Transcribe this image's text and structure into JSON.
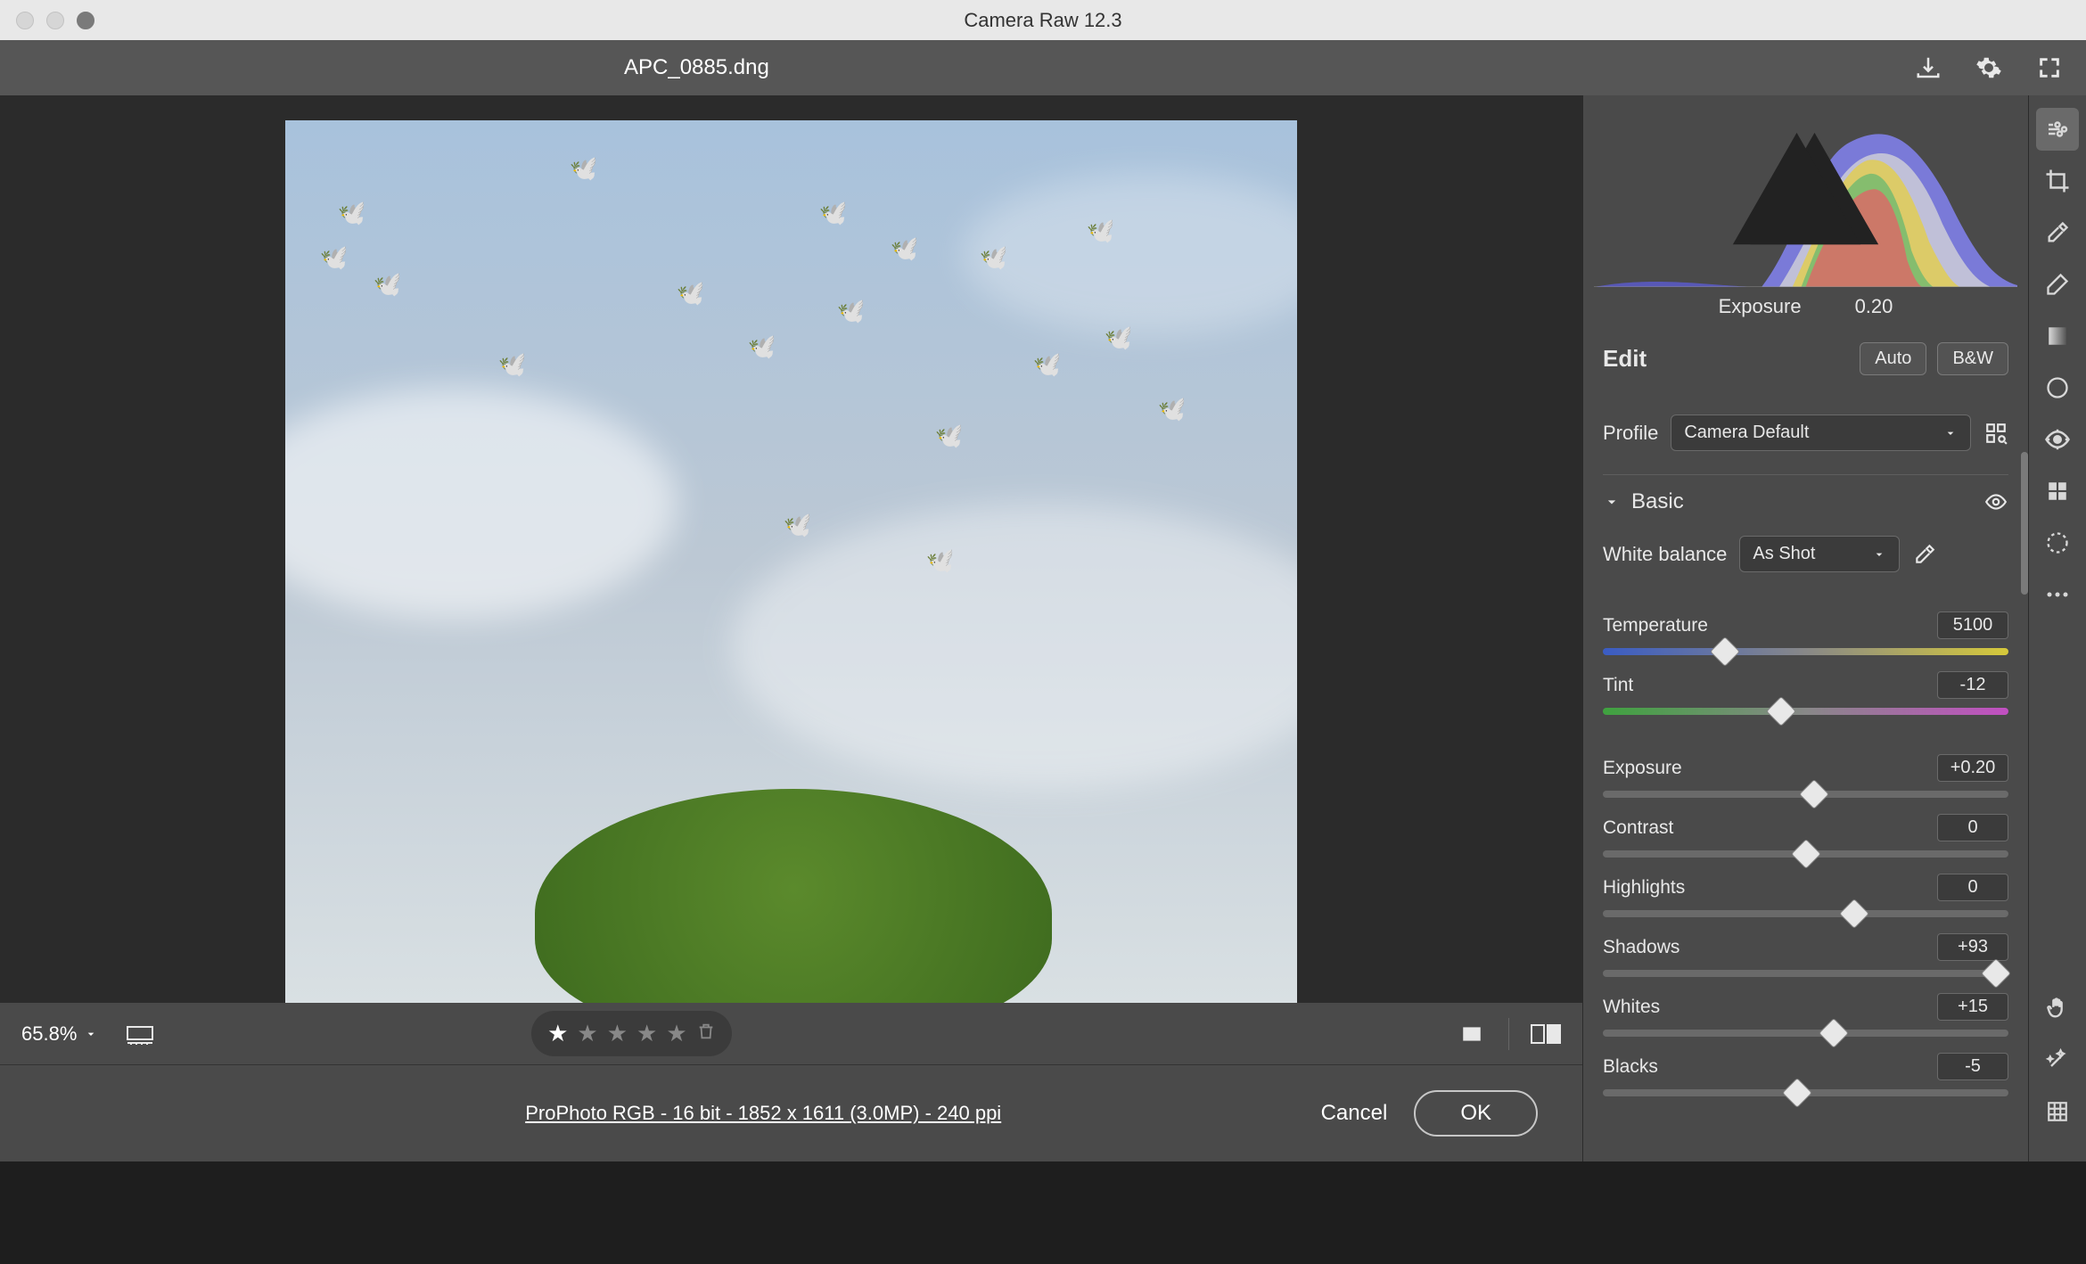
{
  "title": "Camera Raw 12.3",
  "filename": "APC_0885.dng",
  "zoom": "65.8%",
  "rating": 1,
  "compare": {
    "before_after": "before-after"
  },
  "footer_info": "ProPhoto RGB - 16 bit - 1852 x 1611 (3.0MP) - 240 ppi",
  "buttons": {
    "cancel": "Cancel",
    "ok": "OK",
    "auto": "Auto",
    "bw": "B&W"
  },
  "histogram_readout": {
    "label": "Exposure",
    "value": "0.20"
  },
  "panel": {
    "edit_label": "Edit",
    "profile_label": "Profile",
    "profile_value": "Camera Default",
    "basic_label": "Basic",
    "wb_label": "White balance",
    "wb_value": "As Shot"
  },
  "sliders": {
    "temperature": {
      "label": "Temperature",
      "value": "5100",
      "pos": 30
    },
    "tint": {
      "label": "Tint",
      "value": "-12",
      "pos": 44
    },
    "exposure": {
      "label": "Exposure",
      "value": "+0.20",
      "pos": 52
    },
    "contrast": {
      "label": "Contrast",
      "value": "0",
      "pos": 50
    },
    "highlights": {
      "label": "Highlights",
      "value": "0",
      "pos": 62
    },
    "shadows": {
      "label": "Shadows",
      "value": "+93",
      "pos": 97
    },
    "whites": {
      "label": "Whites",
      "value": "+15",
      "pos": 57
    },
    "blacks": {
      "label": "Blacks",
      "value": "-5",
      "pos": 48
    }
  },
  "tools": [
    "edit",
    "crop",
    "eyedropper",
    "brush",
    "gradient",
    "radial",
    "redeye",
    "presets",
    "spot",
    "more",
    "hand",
    "wand",
    "grid"
  ]
}
